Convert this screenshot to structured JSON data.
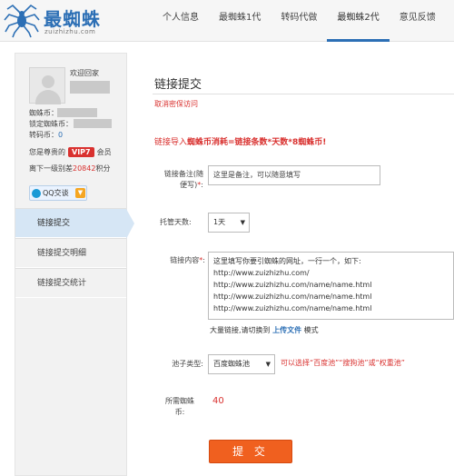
{
  "header": {
    "logo_text": "最蜘蛛",
    "logo_sub": "zuizhizhu.com",
    "nav": [
      "个人信息",
      "最蜘蛛1代",
      "转码代做",
      "最蜘蛛2代",
      "意见反馈"
    ],
    "active_nav_index": 3
  },
  "sidebar": {
    "welcome": "欢迎回家",
    "coins_label": "蜘蛛币：",
    "locked_label": "锁定蜘蛛币：",
    "code_coins_label": "转码币：",
    "code_coins_value": "0",
    "vip_prefix": "您是尊贵的",
    "vip_badge": "VIP7",
    "vip_suffix": "会员",
    "level_prefix": "离下一级别差",
    "level_points": "20842",
    "level_suffix": "积分",
    "qq_label": "QQ交谈",
    "menu": [
      "链接提交",
      "链接提交明细",
      "链接提交统计"
    ],
    "active_menu_index": 0
  },
  "main": {
    "title": "链接提交",
    "cancel_link": "取消密保访问",
    "notice_prefix": "链接导入",
    "notice_bold": "蜘蛛币消耗=链接条数*天数*8蜘蛛币!",
    "remark_label_1": "链接备注(随",
    "remark_label_2": "便写)",
    "remark_value": "这里是备注，可以随意填写",
    "days_label": "托管天数:",
    "days_value": "1天",
    "content_label": "链接内容",
    "content_lines": "这里填写你要引蜘蛛的网址，一行一个，如下:\nhttp://www.zuizhizhu.com/\nhttp://www.zuizhizhu.com/name/name.html\nhttp://www.zuizhizhu.com/name/name.html\nhttp://www.zuizhizhu.com/name/name.html",
    "batch_prefix": "大量链接,请切换到",
    "batch_link": "上传文件",
    "batch_suffix": "模式",
    "pool_label": "池子类型:",
    "pool_value": "百度蜘蛛池",
    "pool_hint": "可以选择“百度池”“搜狗池”或“权重池”",
    "cost_label_1": "所需蜘蛛",
    "cost_label_2": "币:",
    "cost_value": "40",
    "submit": "提 交"
  },
  "colors": {
    "brand_blue": "#2c6fb5",
    "alert_red": "#d9312f",
    "submit_orange": "#f0601f"
  }
}
